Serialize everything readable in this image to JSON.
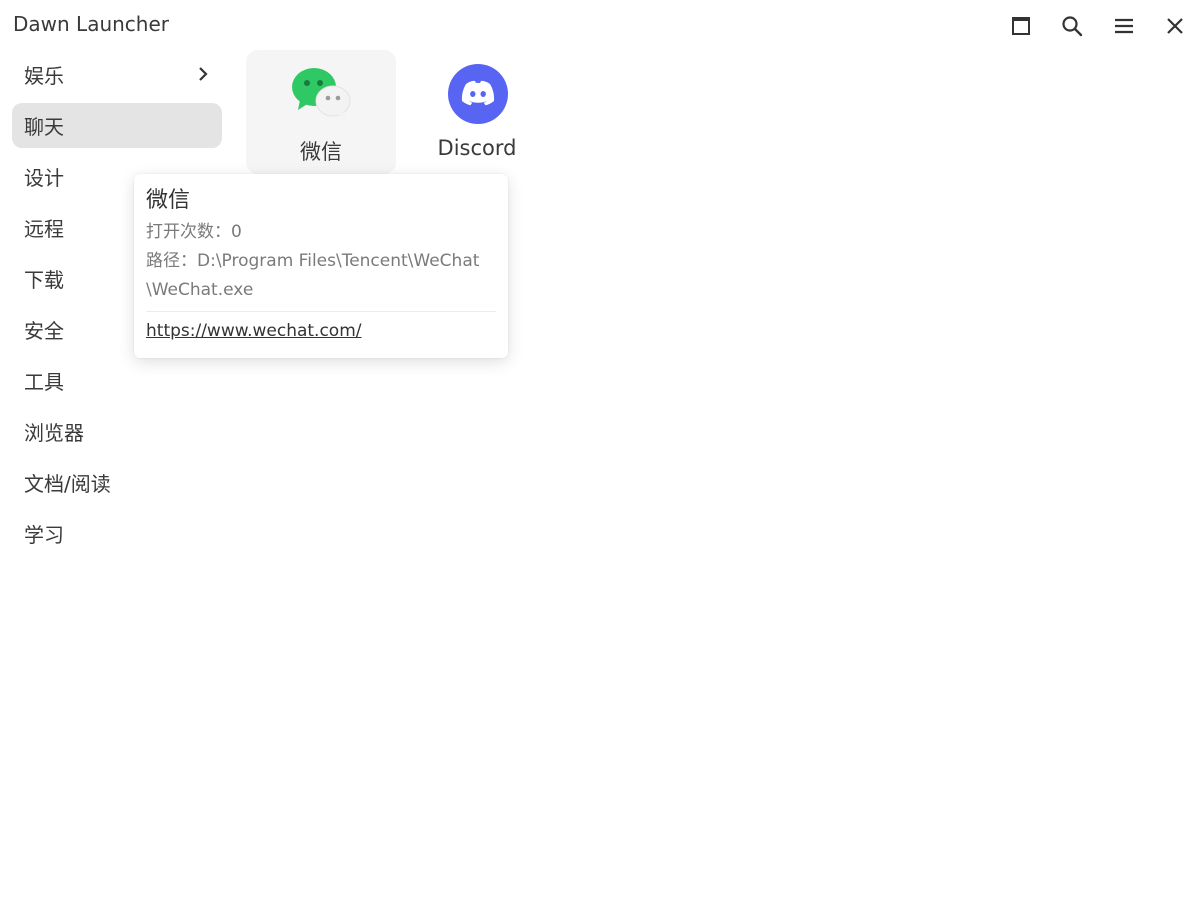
{
  "window": {
    "title": "Dawn Launcher",
    "controls": [
      {
        "name": "maximize-icon"
      },
      {
        "name": "search-icon"
      },
      {
        "name": "menu-icon"
      },
      {
        "name": "close-icon"
      }
    ]
  },
  "sidebar": {
    "items": [
      {
        "label": "娱乐",
        "has_submenu": true
      },
      {
        "label": "聊天",
        "active": true
      },
      {
        "label": "设计"
      },
      {
        "label": "远程"
      },
      {
        "label": "下载"
      },
      {
        "label": "安全"
      },
      {
        "label": "工具"
      },
      {
        "label": "浏览器"
      },
      {
        "label": "文档/阅读"
      },
      {
        "label": "学习"
      }
    ]
  },
  "apps": [
    {
      "label": "微信",
      "icon": "wechat-icon",
      "color": "#2dc100"
    },
    {
      "label": "Discord",
      "icon": "discord-icon",
      "color": "#5865f2"
    }
  ],
  "tooltip": {
    "title": "微信",
    "open_count_label": "打开次数：",
    "open_count": "0",
    "path_label": "路径：",
    "path": "D:\\Program Files\\Tencent\\WeChat\\WeChat.exe",
    "url": "https://www.wechat.com/"
  }
}
